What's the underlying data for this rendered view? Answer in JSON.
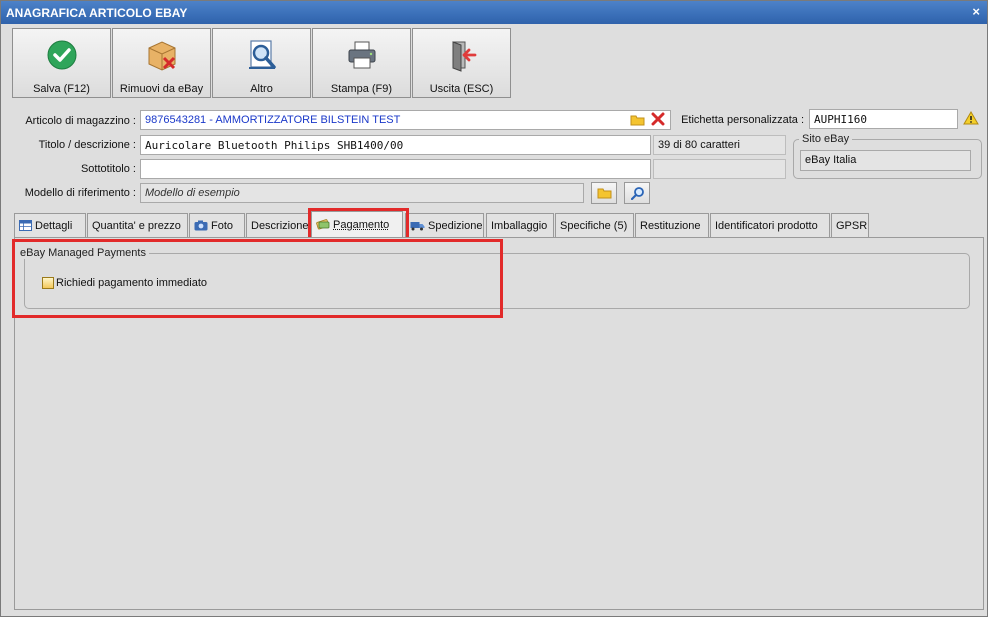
{
  "window": {
    "title": "ANAGRAFICA ARTICOLO EBAY",
    "close_label": "×"
  },
  "toolbar": {
    "save_label": "Salva (F12)",
    "remove_label": "Rimuovi da eBay",
    "other_label": "Altro",
    "print_label": "Stampa (F9)",
    "exit_label": "Uscita (ESC)"
  },
  "form": {
    "article_label": "Articolo di magazzino :",
    "article_value": "9876543281 - AMMORTIZZATORE BILSTEIN TEST",
    "custom_label_label": "Etichetta personalizzata :",
    "custom_label_value": "AUPHI160",
    "title_label": "Titolo / descrizione :",
    "title_value": "Auricolare Bluetooth Philips SHB1400/00",
    "char_count": "39 di 80 caratteri",
    "subtitle_label": "Sottotitolo :",
    "subtitle_value": "",
    "model_label": "Modello di riferimento :",
    "model_value": "Modello di esempio",
    "site_group_title": "Sito eBay",
    "site_value": "eBay Italia"
  },
  "tabs": [
    {
      "label": "Dettagli"
    },
    {
      "label": "Quantita' e prezzo"
    },
    {
      "label": "Foto"
    },
    {
      "label": "Descrizione"
    },
    {
      "label": "Pagamento"
    },
    {
      "label": "Spedizione"
    },
    {
      "label": "Imballaggio"
    },
    {
      "label": "Specifiche (5)"
    },
    {
      "label": "Restituzione"
    },
    {
      "label": "Identificatori prodotto"
    },
    {
      "label": "GPSR"
    }
  ],
  "active_tab": "Pagamento",
  "payment": {
    "group_title": "eBay Managed Payments",
    "immediate_label": "Richiedi pagamento immediato",
    "immediate_checked": false
  },
  "colors": {
    "titlebar": "#3a6fb8",
    "highlight": "#e22a2a",
    "link_text": "#1a38c9"
  }
}
